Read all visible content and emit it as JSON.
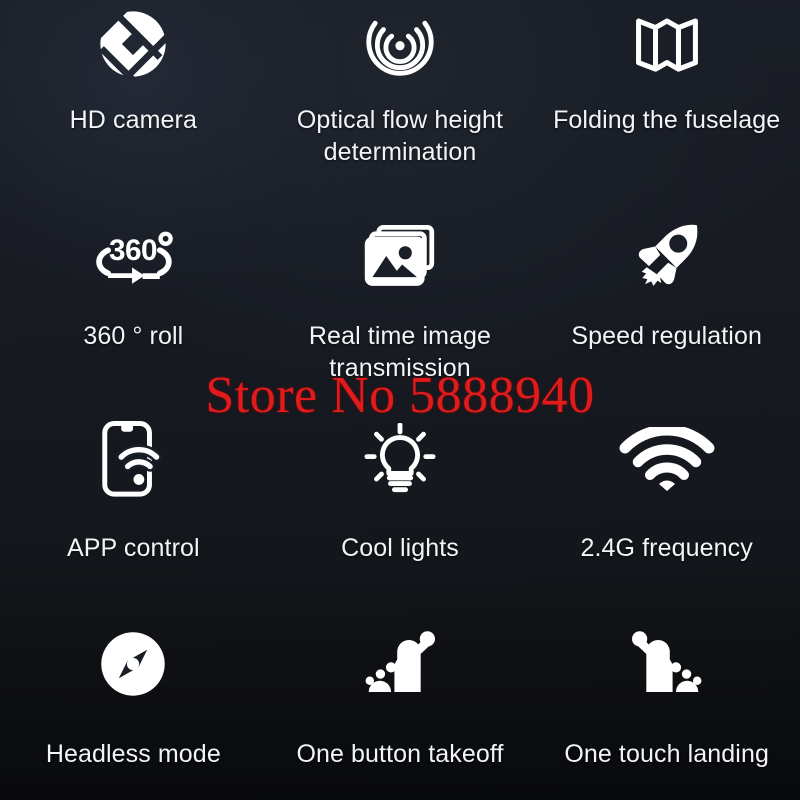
{
  "poster": {
    "background_top": "#1b1f27",
    "background_bottom": "#101216",
    "icon_color": "#ffffff",
    "label_color": "#f2f4f6"
  },
  "watermark": {
    "text": "Store No 5888940",
    "color": "#e01b1b"
  },
  "features": [
    {
      "label": "HD camera",
      "icon": "shutter-circle-icon"
    },
    {
      "label": "Optical flow height determination",
      "icon": "concentric-waves-icon"
    },
    {
      "label": "Folding the fuselage",
      "icon": "folded-map-icon"
    },
    {
      "label": "360 ° roll",
      "icon": "360-rotation-icon"
    },
    {
      "label": "Real time image transmission",
      "icon": "stacked-photos-icon"
    },
    {
      "label": "Speed regulation",
      "icon": "rocket-icon"
    },
    {
      "label": "APP control",
      "icon": "phone-wifi-icon"
    },
    {
      "label": "Cool lights",
      "icon": "lightbulb-icon"
    },
    {
      "label": "2.4G frequency",
      "icon": "wifi-signal-icon"
    },
    {
      "label": "Headless mode",
      "icon": "compass-icon"
    },
    {
      "label": "One button takeoff",
      "icon": "ascending-bars-arrow-icon"
    },
    {
      "label": "One touch landing",
      "icon": "descending-bars-arrow-icon"
    }
  ]
}
